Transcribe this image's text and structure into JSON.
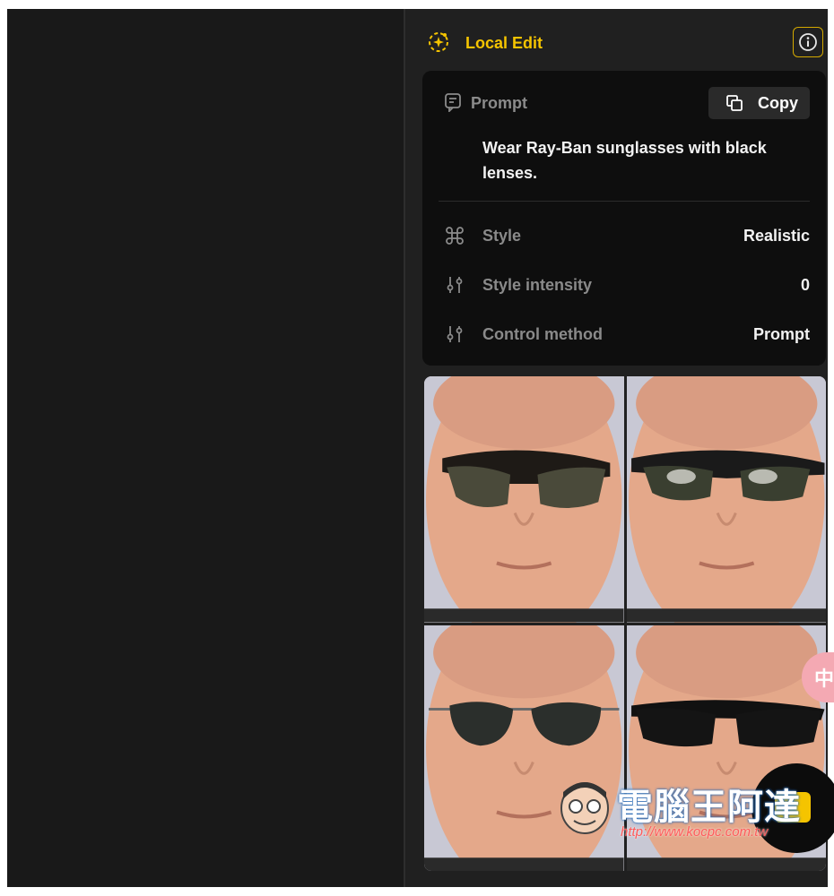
{
  "header": {
    "title": "Local Edit",
    "title_icon": "sparkle-icon",
    "info_icon": "info-icon",
    "accent": "#f5c400"
  },
  "prompt_card": {
    "label": "Prompt",
    "copy_label": "Copy",
    "text": "Wear Ray-Ban sunglasses with black lenses."
  },
  "details": [
    {
      "icon": "style-grid-icon",
      "label": "Style",
      "value": "Realistic"
    },
    {
      "icon": "sliders-icon",
      "label": "Style intensity",
      "value": "0"
    },
    {
      "icon": "sliders-icon",
      "label": "Control method",
      "value": "Prompt"
    }
  ],
  "results": [
    {
      "description": "wayfarer-tortoise"
    },
    {
      "description": "clubmaster-gold"
    },
    {
      "description": "aviator-silver"
    },
    {
      "description": "wayfarer-black"
    }
  ],
  "overlay": {
    "lang_badge": "中"
  },
  "watermark": {
    "title": "電腦王阿達",
    "url": "http://www.kocpc.com.tw"
  }
}
